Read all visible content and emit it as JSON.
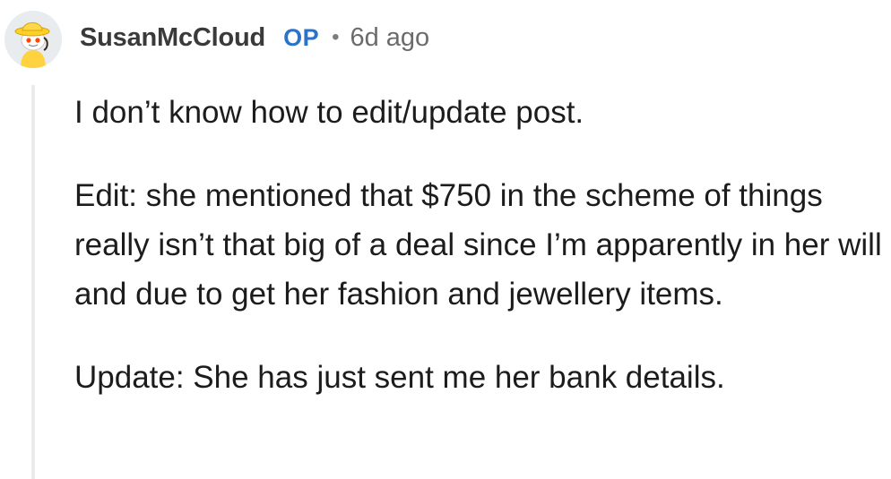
{
  "comment": {
    "author": "SusanMcCloud",
    "op_label": "OP",
    "separator": "•",
    "timestamp": "6d ago",
    "avatar_icon": "snoo-avatar-yellow-hat-icon",
    "paragraphs": [
      "I don’t know how to edit/update post.",
      "Edit: she mentioned that $750 in the scheme of things really isn’t that big of a deal since I’m apparently in her will and due to get her fashion and jewellery items.",
      "Update: She has just sent me her bank details."
    ]
  },
  "colors": {
    "username": "#3a3a3a",
    "op_badge": "#2b73c9",
    "meta": "#6b6b6b",
    "thread_line": "#ebebeb",
    "text": "#1c1c1c"
  }
}
